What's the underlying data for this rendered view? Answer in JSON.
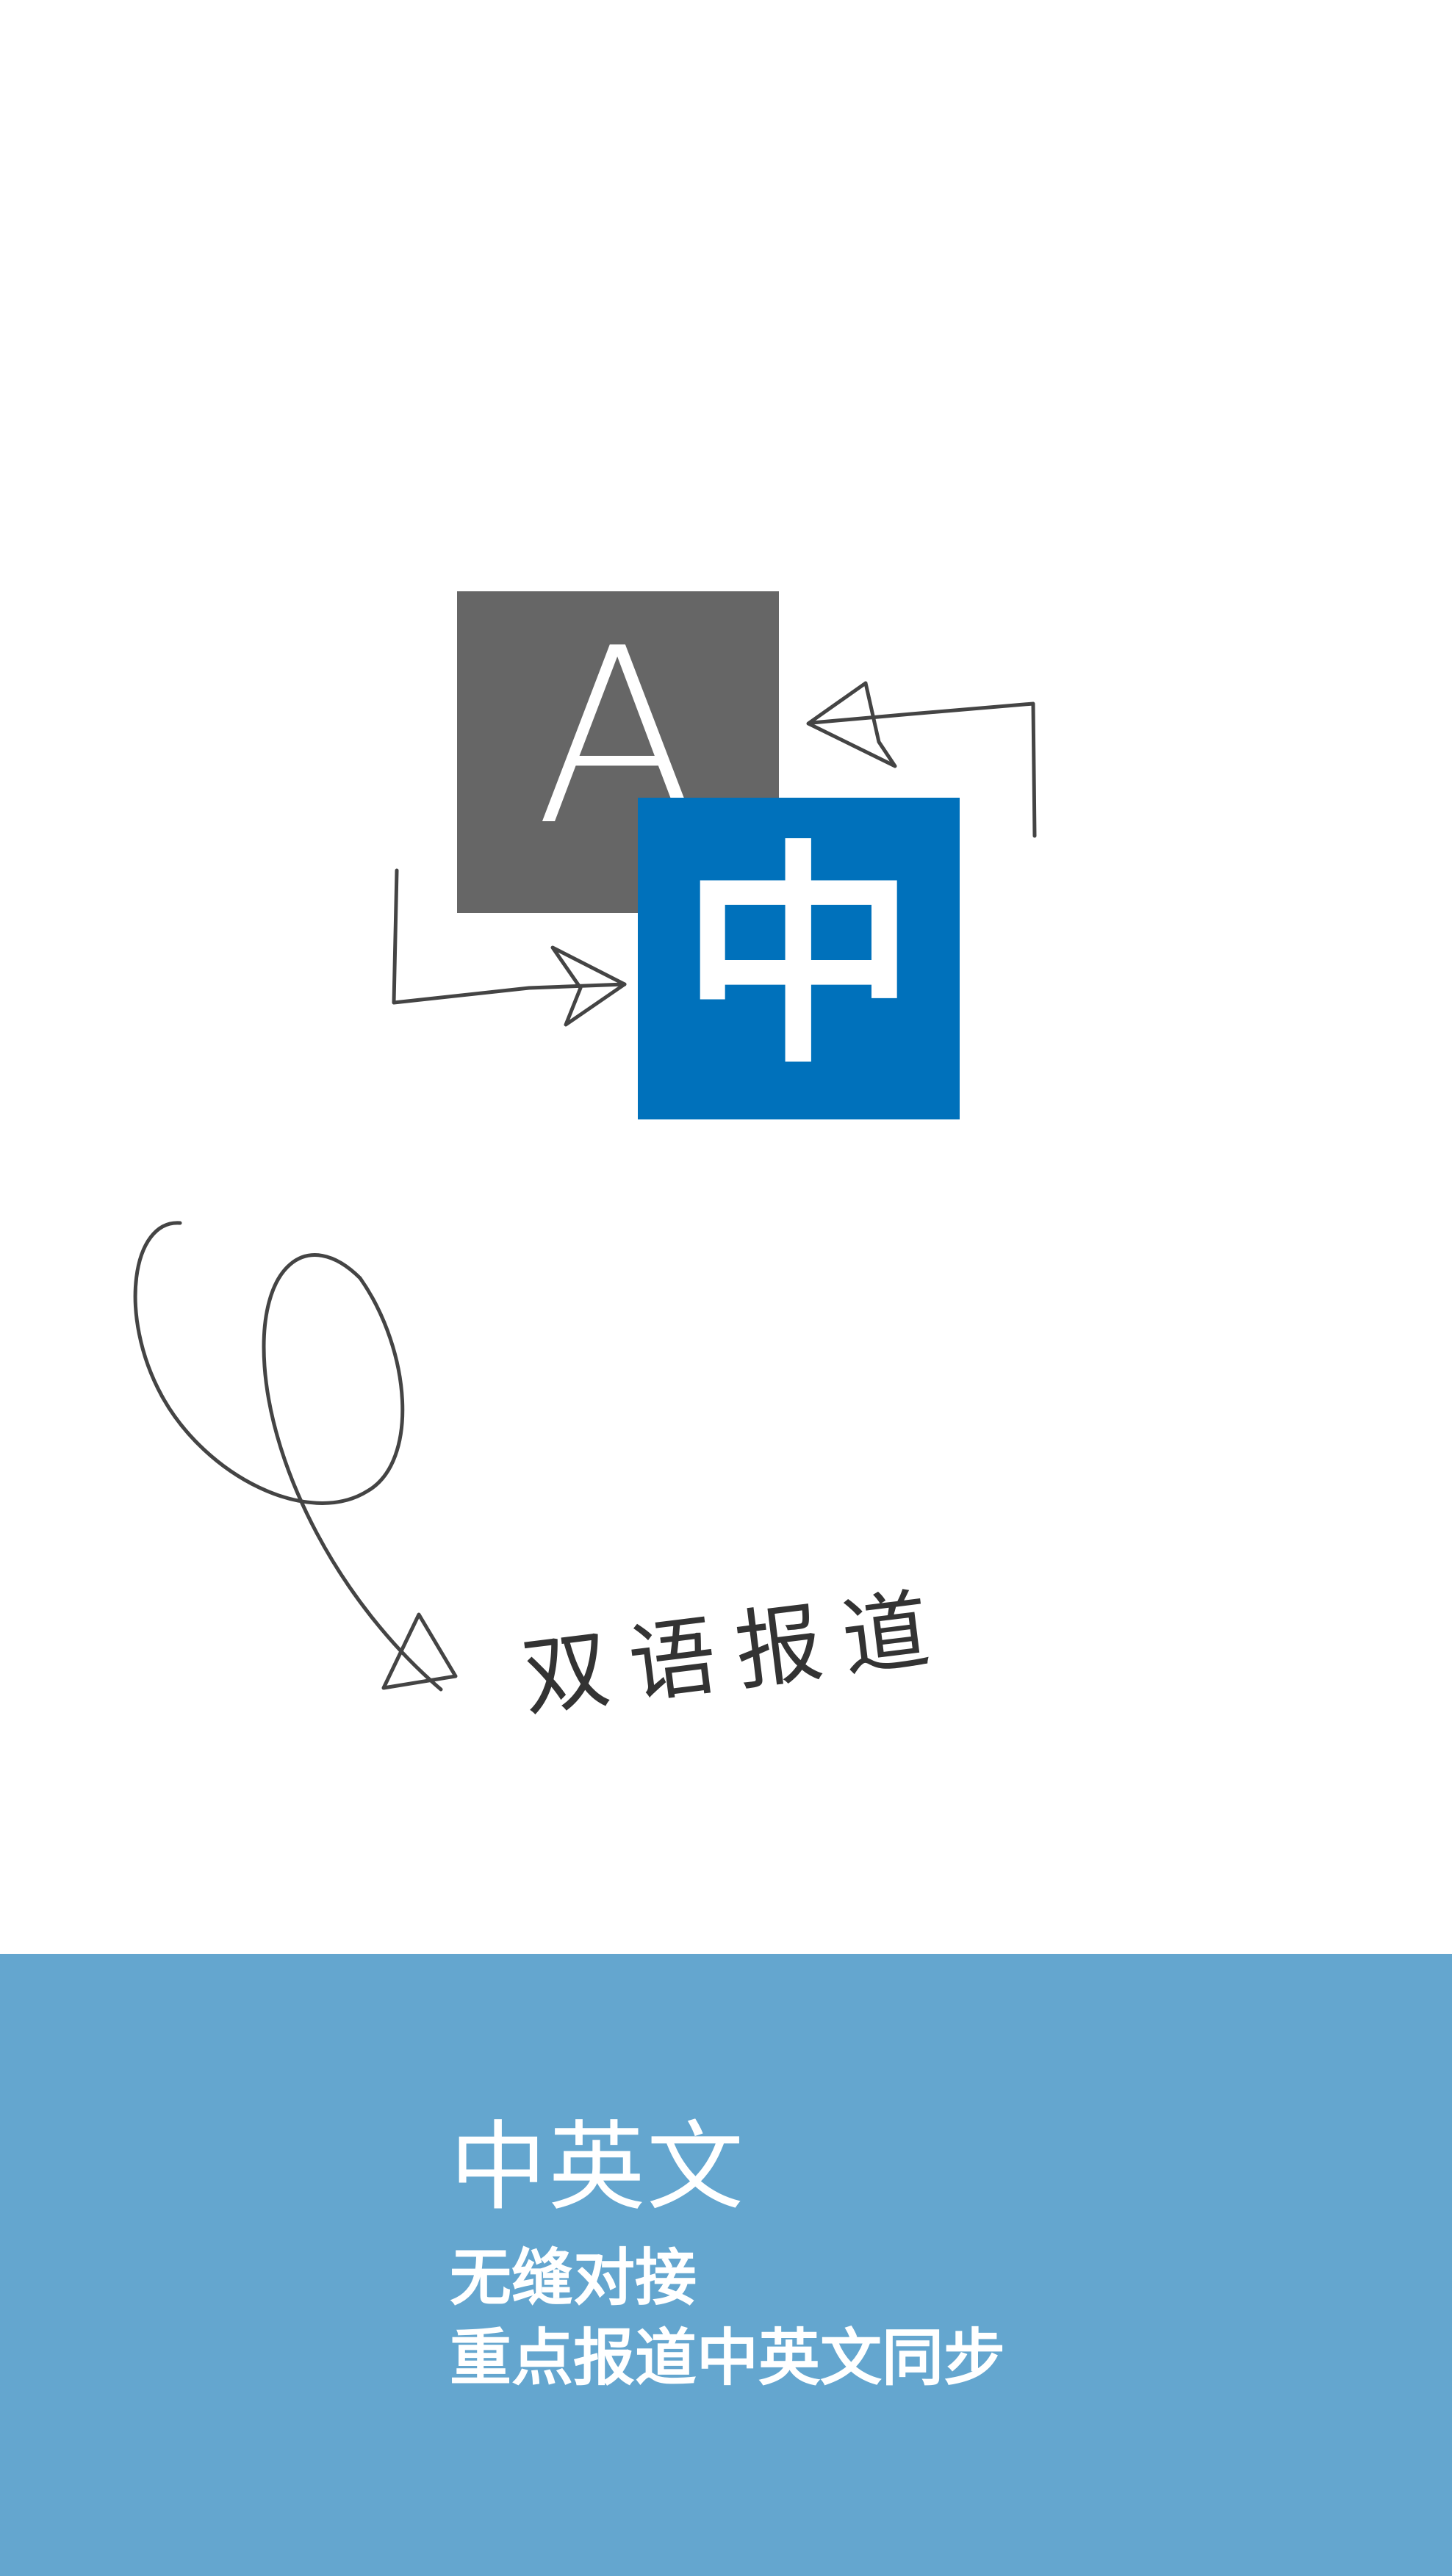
{
  "illustration": {
    "latin_glyph": "A",
    "chinese_glyph": "中",
    "handwritten_label": "双语报道",
    "colors": {
      "latin_tile": "#666666",
      "chinese_tile": "#0071bb",
      "sketch_stroke": "#444444"
    }
  },
  "banner": {
    "background": "#64a6cf",
    "title": "中英文",
    "line1": "无缝对接",
    "line2": "重点报道中英文同步"
  }
}
